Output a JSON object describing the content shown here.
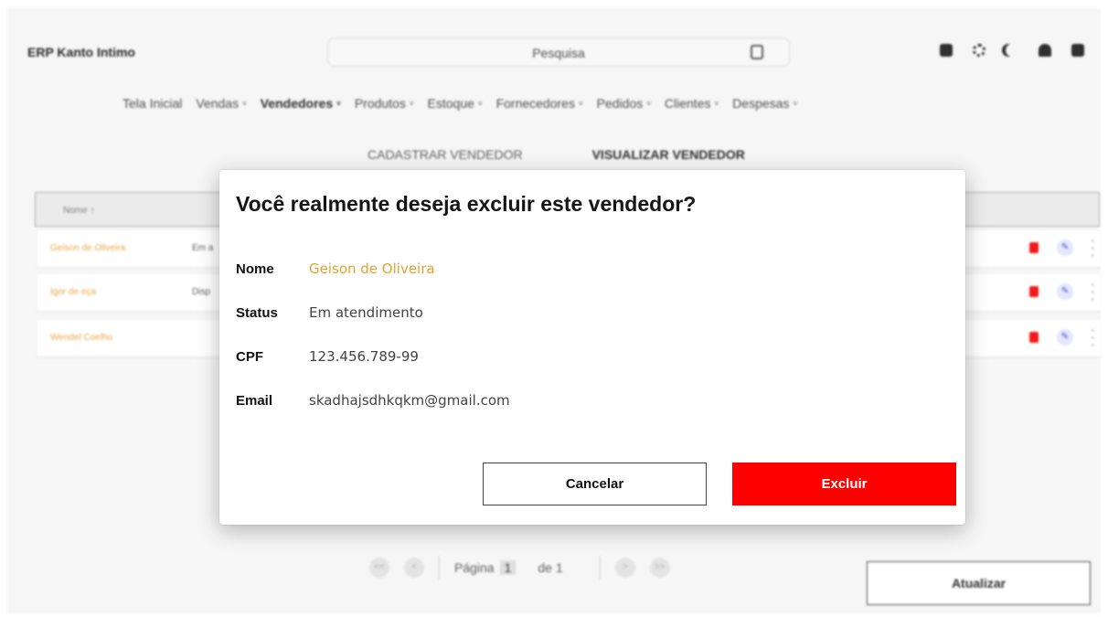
{
  "app": {
    "brand": "ERP Kanto Intimo"
  },
  "search": {
    "placeholder": "Pesquisa",
    "icon": "search-icon"
  },
  "top_icons": [
    "help-icon",
    "gear-icon",
    "moon-icon",
    "bell-icon",
    "user-icon"
  ],
  "nav": {
    "items": [
      {
        "label": "Tela Inicial",
        "has_menu": false
      },
      {
        "label": "Vendas",
        "has_menu": true
      },
      {
        "label": "Vendedores",
        "has_menu": true,
        "active": true
      },
      {
        "label": "Produtos",
        "has_menu": true
      },
      {
        "label": "Estoque",
        "has_menu": true
      },
      {
        "label": "Fornecedores",
        "has_menu": true
      },
      {
        "label": "Pedidos",
        "has_menu": true
      },
      {
        "label": "Clientes",
        "has_menu": true
      },
      {
        "label": "Despesas",
        "has_menu": true
      }
    ],
    "chevron": "˅"
  },
  "subnav": {
    "register": "CADASTRAR VENDEDOR",
    "view": "VISUALIZAR VENDEDOR"
  },
  "table": {
    "header": {
      "name_col": "Nome ↑"
    },
    "rows": [
      {
        "name": "Geison de Oliveira",
        "status": "Em a"
      },
      {
        "name": "Igor de eça",
        "status": "Disp"
      },
      {
        "name": "Wendel Coelho",
        "status": ""
      }
    ]
  },
  "pagination": {
    "first": "<<",
    "prev": "<",
    "page_label": "Página",
    "current": "1",
    "of_label": "de 1",
    "next": ">",
    "last": ">>"
  },
  "update_button": "Atualizar",
  "modal": {
    "title": "Você realmente deseja excluir este vendedor?",
    "fields": {
      "name_label": "Nome",
      "name_value": "Geison de Oliveira",
      "status_label": "Status",
      "status_value": "Em atendimento",
      "cpf_label": "CPF",
      "cpf_value": "123.456.789-99",
      "email_label": "Email",
      "email_value": "skadhajsdhkqkm@gmail.com"
    },
    "cancel": "Cancelar",
    "delete": "Excluir"
  },
  "colors": {
    "accent": "#e6a22e",
    "danger": "#ff0000",
    "edit_icon": "#3140d8"
  }
}
